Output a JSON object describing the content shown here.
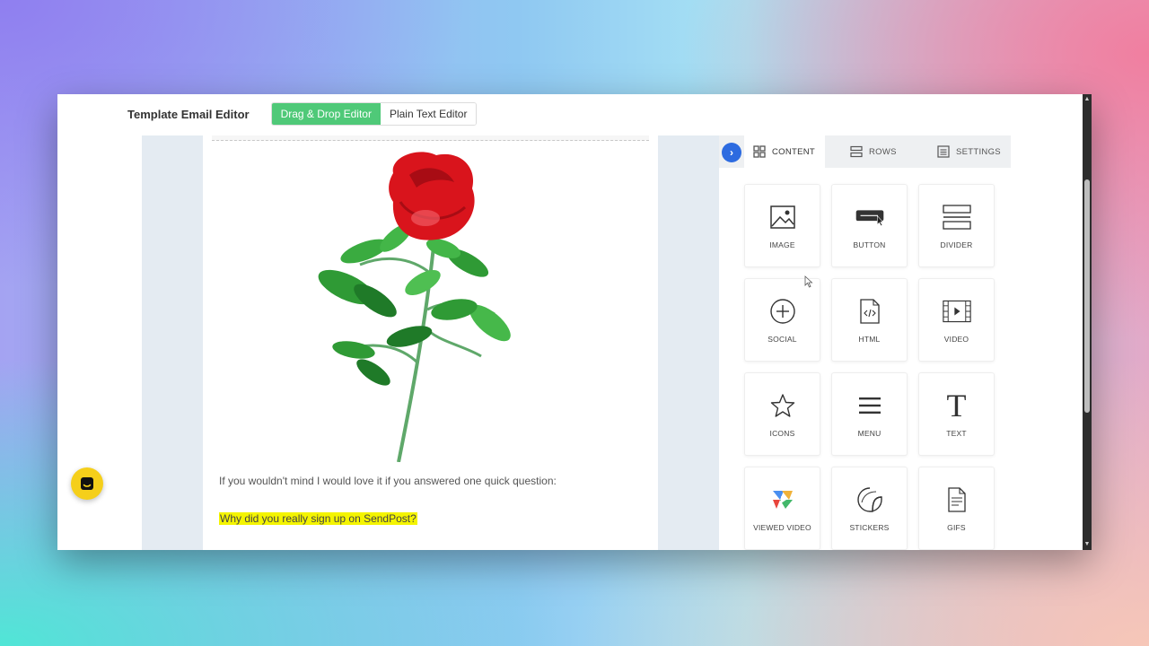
{
  "toolbar": {
    "title": "Template Email Editor",
    "modes": [
      {
        "label": "Drag & Drop Editor",
        "active": true
      },
      {
        "label": "Plain Text Editor",
        "active": false
      }
    ]
  },
  "email": {
    "paragraph": "If you wouldn't mind I would love it if you answered one quick question:",
    "highlight": "Why did you really sign up on SendPost?"
  },
  "sidebar": {
    "tabs": [
      {
        "label": "CONTENT",
        "icon": "grid-icon",
        "active": true
      },
      {
        "label": "ROWS",
        "icon": "rows-icon",
        "active": false
      },
      {
        "label": "SETTINGS",
        "icon": "settings-icon",
        "active": false
      }
    ],
    "blocks": [
      {
        "label": "IMAGE",
        "icon": "image-icon"
      },
      {
        "label": "BUTTON",
        "icon": "button-icon"
      },
      {
        "label": "DIVIDER",
        "icon": "divider-icon"
      },
      {
        "label": "SOCIAL",
        "icon": "plus-circle-icon"
      },
      {
        "label": "HTML",
        "icon": "html-file-icon"
      },
      {
        "label": "VIDEO",
        "icon": "film-icon"
      },
      {
        "label": "ICONS",
        "icon": "star-icon"
      },
      {
        "label": "MENU",
        "icon": "menu-icon"
      },
      {
        "label": "TEXT",
        "icon": "text-t-icon"
      },
      {
        "label": "VIEWED VIDEO",
        "icon": "viewed-video-icon"
      },
      {
        "label": "STICKERS",
        "icon": "sticker-icon"
      },
      {
        "label": "GIFS",
        "icon": "gif-file-icon"
      }
    ]
  },
  "colors": {
    "accent_green": "#4fc978",
    "collapse_blue": "#2d6be0",
    "highlight_yellow": "#f4f400",
    "chat_yellow": "#f5cf1a"
  }
}
